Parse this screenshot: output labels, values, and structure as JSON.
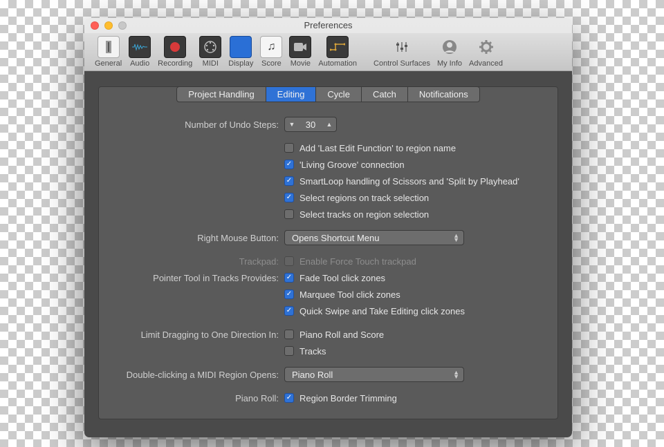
{
  "window": {
    "title": "Preferences"
  },
  "toolbar": {
    "items": [
      {
        "id": "general",
        "label": "General"
      },
      {
        "id": "audio",
        "label": "Audio"
      },
      {
        "id": "recording",
        "label": "Recording"
      },
      {
        "id": "midi",
        "label": "MIDI"
      },
      {
        "id": "display",
        "label": "Display"
      },
      {
        "id": "score",
        "label": "Score"
      },
      {
        "id": "movie",
        "label": "Movie"
      },
      {
        "id": "automation",
        "label": "Automation"
      },
      {
        "id": "control-surfaces",
        "label": "Control Surfaces"
      },
      {
        "id": "my-info",
        "label": "My Info"
      },
      {
        "id": "advanced",
        "label": "Advanced"
      }
    ]
  },
  "tabs": {
    "items": [
      "Project Handling",
      "Editing",
      "Cycle",
      "Catch",
      "Notifications"
    ],
    "active": "Editing"
  },
  "form": {
    "undo": {
      "label": "Number of Undo Steps:",
      "value": "30"
    },
    "checks1": [
      {
        "label": "Add 'Last Edit Function' to region name",
        "checked": false
      },
      {
        "label": "'Living Groove' connection",
        "checked": true
      },
      {
        "label": "SmartLoop handling of Scissors and 'Split by Playhead'",
        "checked": true
      },
      {
        "label": "Select regions on track selection",
        "checked": true
      },
      {
        "label": "Select tracks on region selection",
        "checked": false
      }
    ],
    "rmb": {
      "label": "Right Mouse Button:",
      "value": "Opens Shortcut Menu"
    },
    "trackpad": {
      "label": "Trackpad:",
      "option": "Enable Force Touch trackpad",
      "checked": false,
      "disabled": true
    },
    "pointer": {
      "label": "Pointer Tool in Tracks Provides:",
      "options": [
        {
          "label": "Fade Tool click zones",
          "checked": true
        },
        {
          "label": "Marquee Tool click zones",
          "checked": true
        },
        {
          "label": "Quick Swipe and Take Editing click zones",
          "checked": true
        }
      ]
    },
    "limitdrag": {
      "label": "Limit Dragging to One Direction In:",
      "options": [
        {
          "label": "Piano Roll and Score",
          "checked": false
        },
        {
          "label": "Tracks",
          "checked": false
        }
      ]
    },
    "dblclick": {
      "label": "Double-clicking a MIDI Region Opens:",
      "value": "Piano Roll"
    },
    "pianoroll": {
      "label": "Piano Roll:",
      "option": "Region Border Trimming",
      "checked": true
    }
  }
}
